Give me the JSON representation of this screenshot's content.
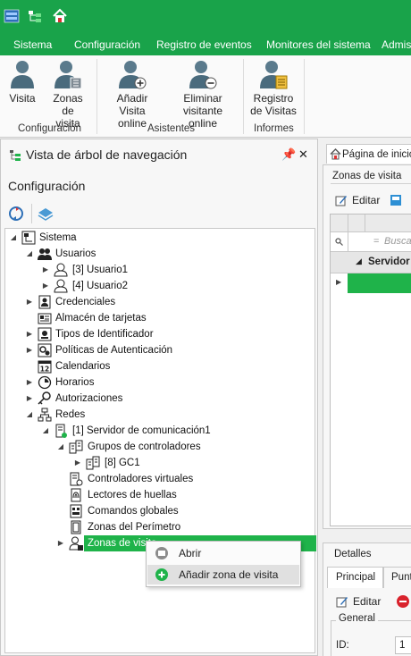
{
  "colors": {
    "accent": "#19a34a",
    "selection": "#1fb34a"
  },
  "quick_access": {
    "icons": [
      "app-logo-icon",
      "tree-view-icon",
      "home-icon"
    ]
  },
  "ribbon": {
    "tabs": [
      "Sistema",
      "Configuración",
      "Registro de eventos",
      "Monitores del sistema",
      "Admis"
    ],
    "buttons": {
      "visita": "Visita",
      "zonas_l1": "Zonas de",
      "zonas_l2": "visita",
      "anadir_l1": "Añadir Visita",
      "anadir_l2": "online",
      "eliminar_l1": "Eliminar",
      "eliminar_l2": "visitante online",
      "registro_l1": "Registro",
      "registro_l2": "de Visitas"
    },
    "groups": [
      "Configuración",
      "Asistentes",
      "Informes"
    ]
  },
  "nav_panel": {
    "title": "Vista de árbol de navegación",
    "section": "Configuración",
    "pin_icon": "pin-icon",
    "close_icon": "close-icon",
    "tree": [
      {
        "label": "Sistema",
        "icon": "system-icon"
      },
      {
        "label": "Usuarios",
        "icon": "users-icon"
      },
      {
        "label": "[3] Usuario1",
        "icon": "user-icon"
      },
      {
        "label": "[4] Usuario2",
        "icon": "user-icon"
      },
      {
        "label": "Credenciales",
        "icon": "credentials-icon"
      },
      {
        "label": "Almacén de tarjetas",
        "icon": "card-store-icon"
      },
      {
        "label": "Tipos de Identificador",
        "icon": "identifier-icon"
      },
      {
        "label": "Políticas de Autenticación",
        "icon": "policy-icon"
      },
      {
        "label": "Calendarios",
        "icon": "calendar-icon"
      },
      {
        "label": "Horarios",
        "icon": "clock-icon"
      },
      {
        "label": "Autorizaciones",
        "icon": "key-icon"
      },
      {
        "label": "Redes",
        "icon": "network-icon"
      },
      {
        "label": "[1] Servidor de comunicación1",
        "icon": "server-icon"
      },
      {
        "label": "Grupos de controladores",
        "icon": "controller-group-icon"
      },
      {
        "label": "[8] GC1",
        "icon": "controller-group-icon"
      },
      {
        "label": "Controladores virtuales",
        "icon": "virtual-controller-icon"
      },
      {
        "label": "Lectores de huellas",
        "icon": "fingerprint-icon"
      },
      {
        "label": "Comandos globales",
        "icon": "command-icon"
      },
      {
        "label": "Zonas del Perímetro",
        "icon": "perimeter-icon"
      },
      {
        "label": "Zonas de visita",
        "icon": "visit-zone-icon"
      }
    ]
  },
  "context_menu": {
    "items": [
      {
        "label": "Abrir",
        "icon": "open-icon"
      },
      {
        "label": "Añadir zona de visita",
        "icon": "add-icon"
      }
    ]
  },
  "doc_tab": {
    "label": "Página de inicio"
  },
  "zonas_panel": {
    "title": "Zonas de visita",
    "edit_label": "Editar",
    "search_placeholder": "Buscar",
    "group_label": "Servidor"
  },
  "detalles": {
    "title": "Detalles",
    "tabs": [
      "Principal",
      "Punt"
    ],
    "edit_label": "Editar",
    "general_label": "General",
    "id_label": "ID:",
    "id_value": "1"
  }
}
